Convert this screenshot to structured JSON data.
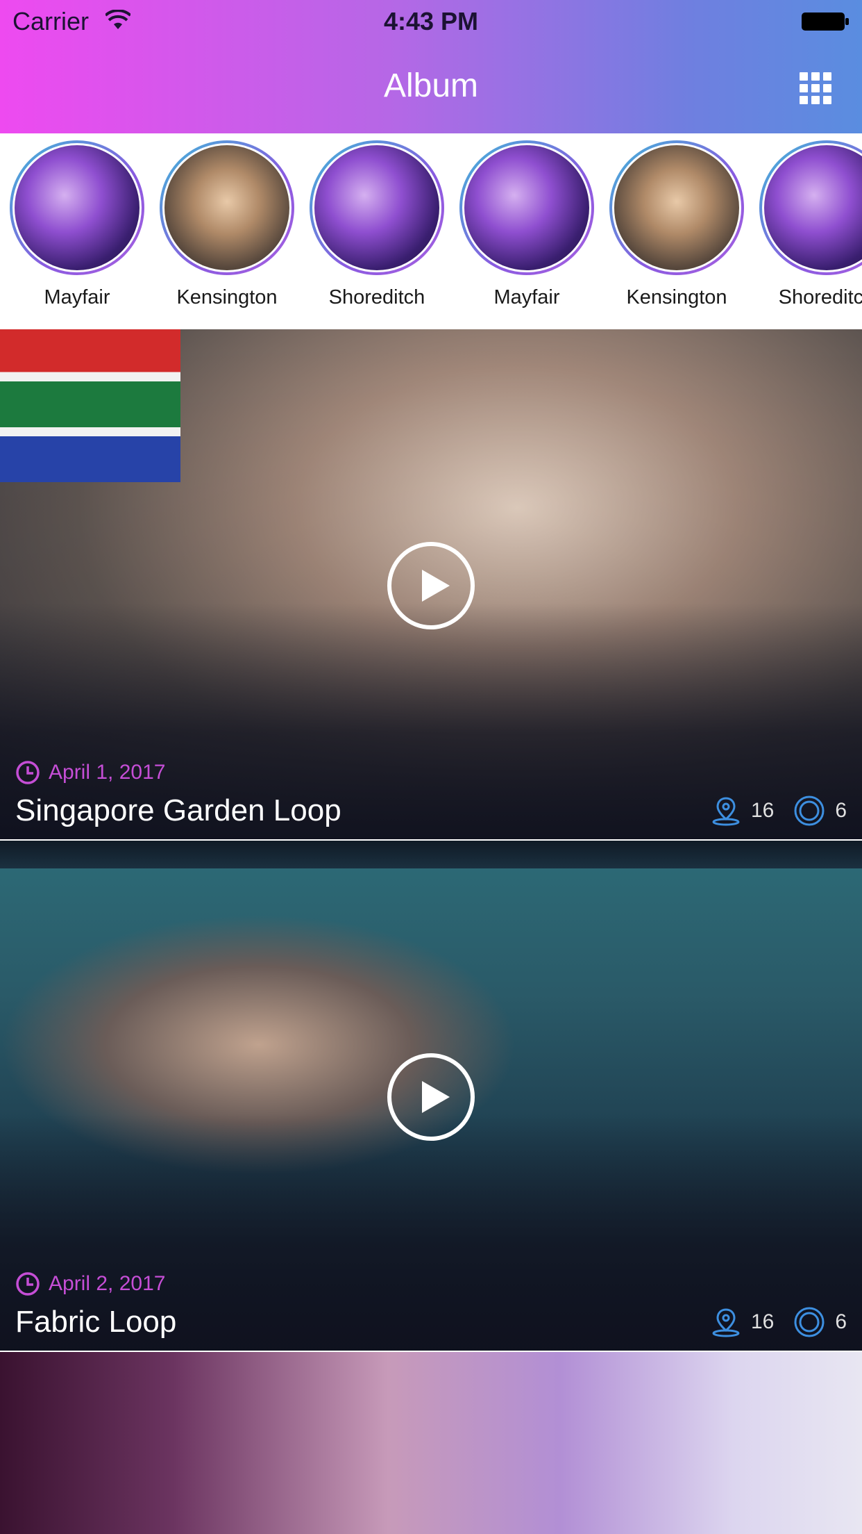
{
  "status_bar": {
    "carrier": "Carrier",
    "time": "4:43 PM"
  },
  "nav": {
    "title": "Album",
    "grid_icon": "grid-icon"
  },
  "stories": [
    {
      "label": "Mayfair"
    },
    {
      "label": "Kensington"
    },
    {
      "label": "Shoreditch"
    },
    {
      "label": "Mayfair"
    },
    {
      "label": "Kensington"
    },
    {
      "label": "Shoreditch"
    }
  ],
  "feed": [
    {
      "date": "April 1, 2017",
      "title": "Singapore Garden Loop",
      "locations": "16",
      "loops": "6"
    },
    {
      "date": "April 2, 2017",
      "title": "Fabric Loop",
      "locations": "16",
      "loops": "6"
    },
    {
      "date": "",
      "title": "",
      "locations": "",
      "loops": ""
    }
  ],
  "colors": {
    "accent_date": "#c54ed6",
    "icon_blue": "#3d8fe0",
    "header_start": "#ee4af0",
    "header_end": "#5a8de0"
  }
}
